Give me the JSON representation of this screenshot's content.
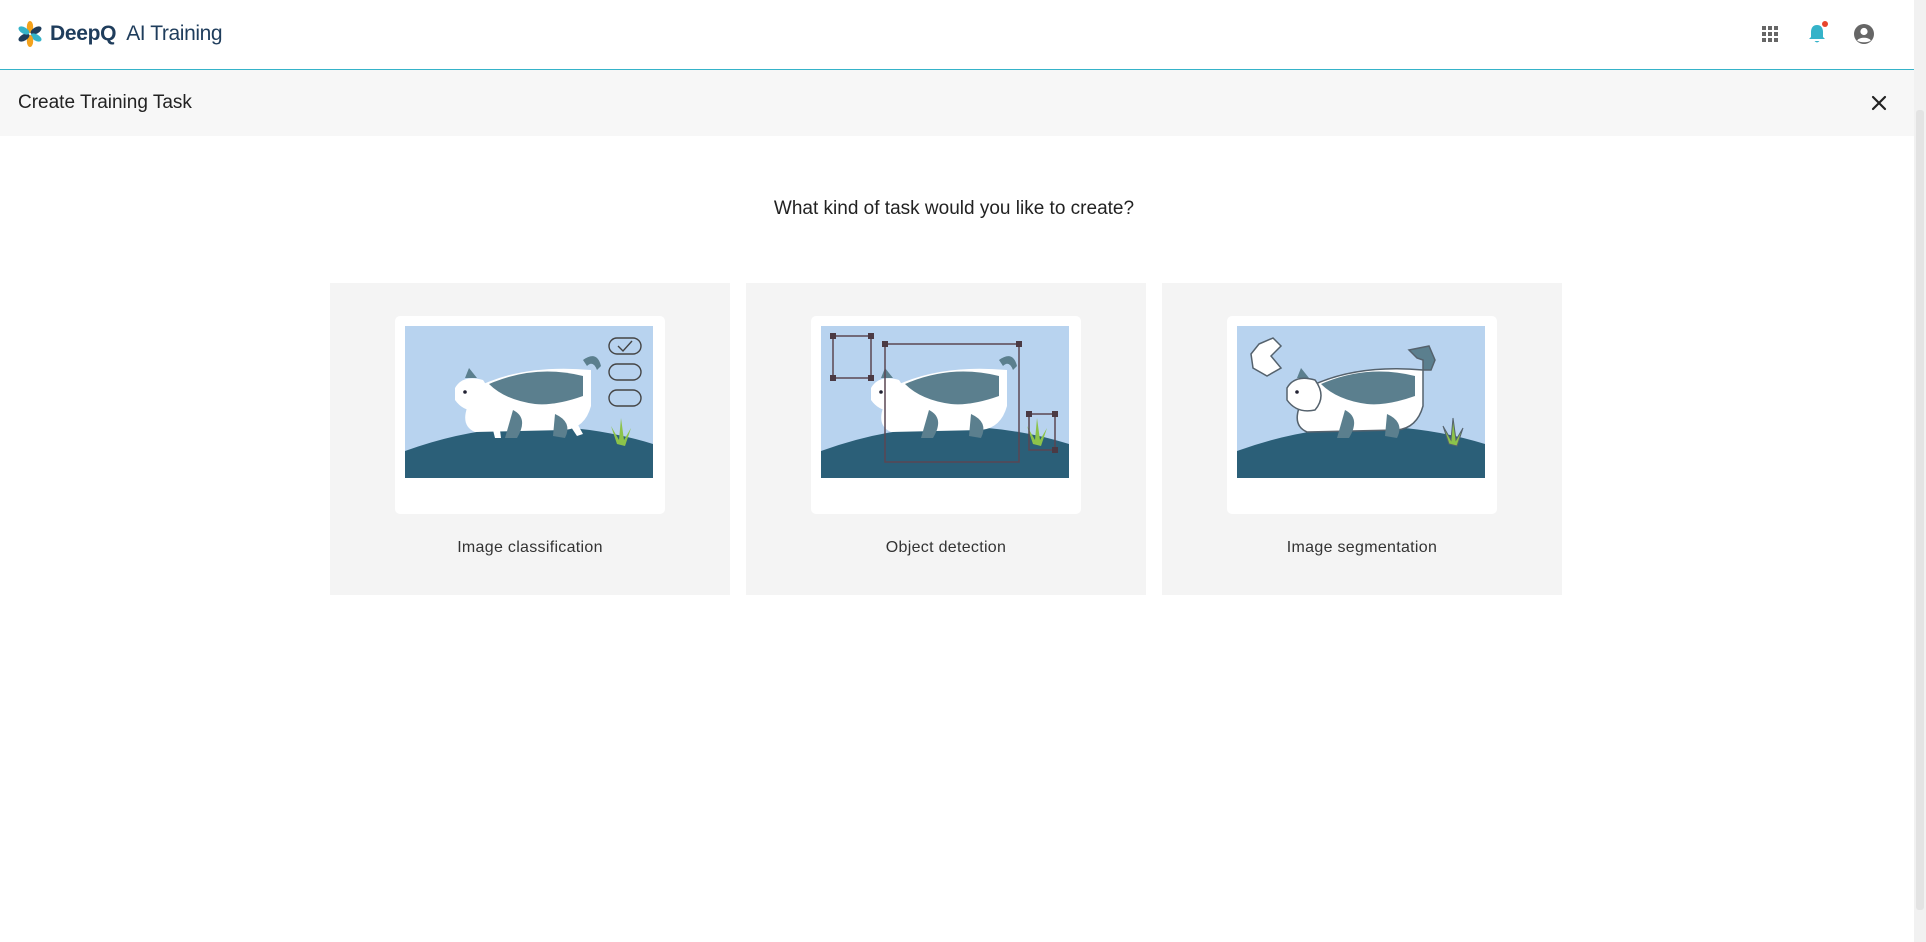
{
  "header": {
    "brand": "DeepQ",
    "product": "AI Training",
    "icons": [
      "apps-grid-icon",
      "bell-icon",
      "account-circle-icon"
    ],
    "accent_color": "#35b3c9",
    "notification_dot_color": "#e8452c"
  },
  "subheader": {
    "title": "Create Training Task",
    "close_icon": "close-icon"
  },
  "main": {
    "question": "What kind of task would you like to create?",
    "task_types": [
      {
        "label": "Image classification"
      },
      {
        "label": "Object detection"
      },
      {
        "label": "Image segmentation"
      }
    ]
  },
  "colors": {
    "sky": "#b8d3ef",
    "hill": "#2b5f78",
    "cat_patch": "#5b7f8e",
    "grass": "#8cc34a",
    "card_bg": "#f4f4f4"
  }
}
